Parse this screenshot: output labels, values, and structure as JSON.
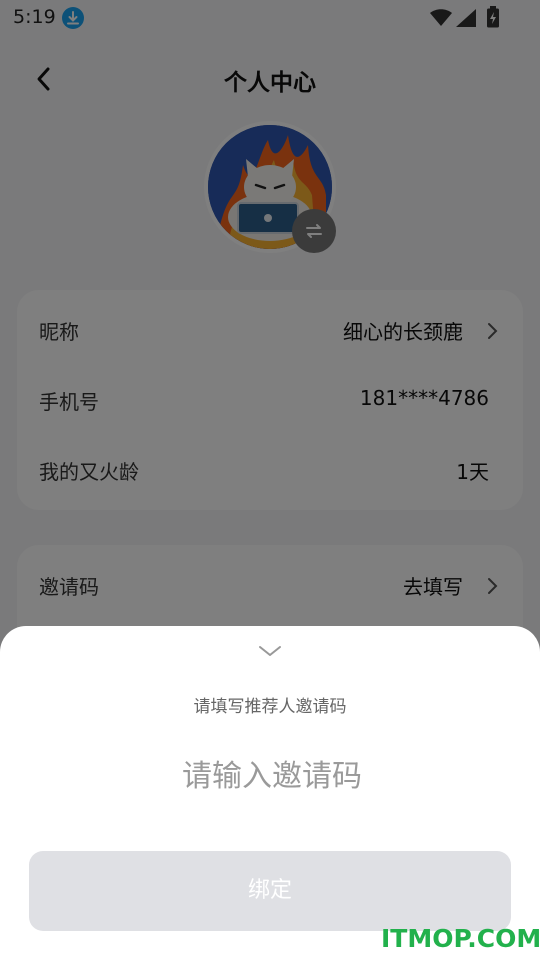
{
  "status_bar": {
    "time": "5:19"
  },
  "header": {
    "title": "个人中心"
  },
  "profile_card": {
    "rows": [
      {
        "label": "昵称",
        "value": "细心的长颈鹿"
      },
      {
        "label": "手机号",
        "value": "181****4786"
      },
      {
        "label": "我的又火龄",
        "value": "1天"
      }
    ]
  },
  "invite_card": {
    "rows": [
      {
        "label": "邀请码",
        "value": "去填写"
      }
    ]
  },
  "sheet": {
    "subtitle": "请填写推荐人邀请码",
    "input_placeholder": "请输入邀请码",
    "input_value": "",
    "bind_label": "绑定"
  },
  "watermark": "ITMOP.COM",
  "colors": {
    "overlay": "rgba(0,0,0,0.5)",
    "download_badge": "#1aa3f0",
    "disabled_button": "#dfe0e4",
    "watermark": "#22b14c"
  },
  "icons": [
    "download-icon",
    "wifi-icon",
    "signal-icon",
    "battery-icon",
    "back-arrow-icon",
    "swap-icon",
    "chevron-right-icon",
    "chevron-down-icon"
  ]
}
